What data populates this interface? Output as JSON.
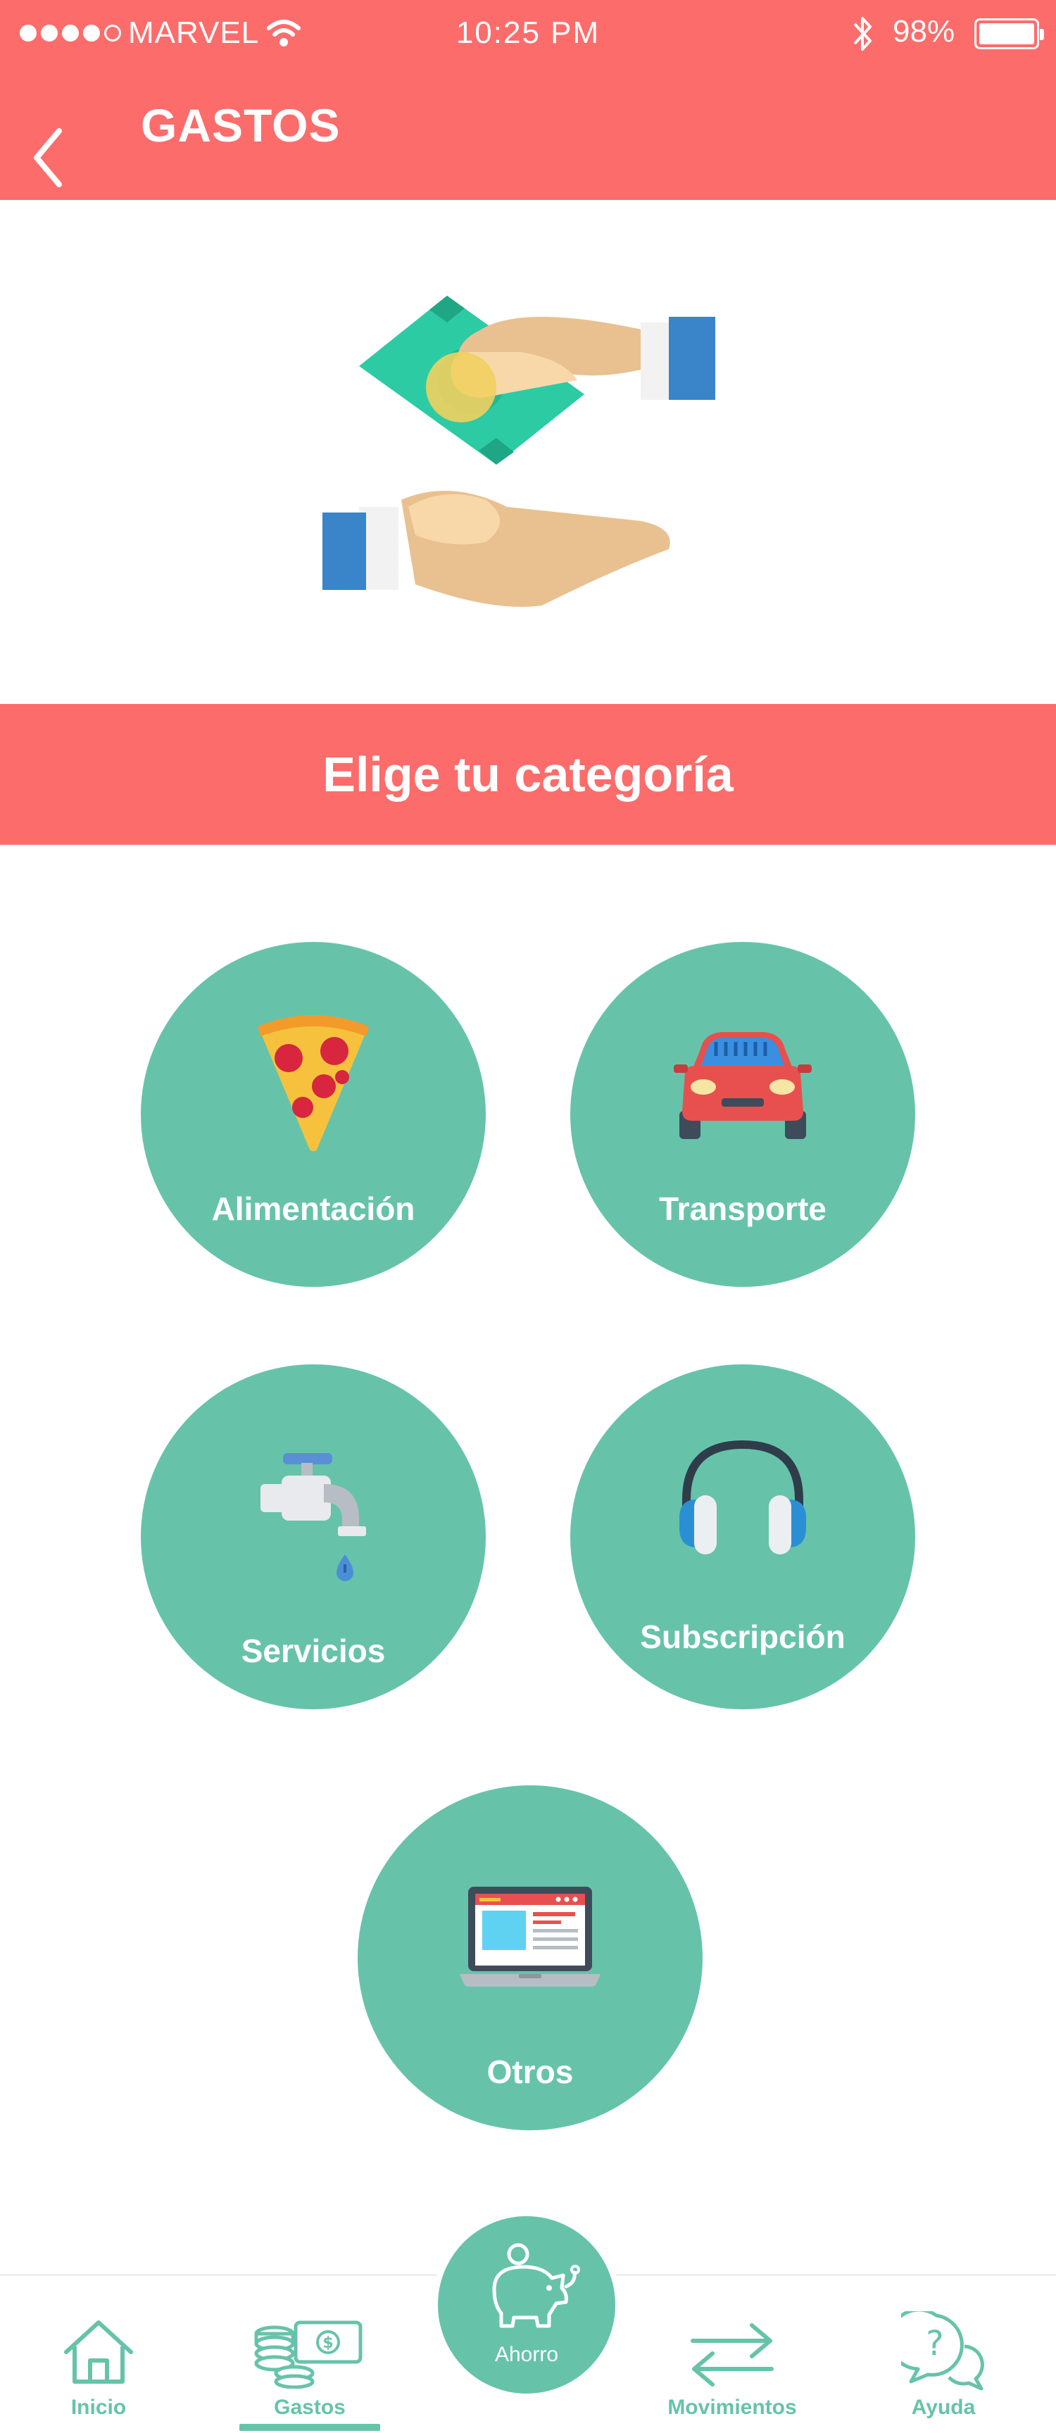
{
  "status_bar": {
    "carrier": "MARVEL",
    "time": "10:25 PM",
    "battery": "98%",
    "signal_bars_filled": 4,
    "signal_bars_total": 5
  },
  "header": {
    "title": "GASTOS",
    "back_icon": "chevron-left-icon"
  },
  "hero": {
    "icon": "money-exchange-hands-icon"
  },
  "banner": {
    "text": "Elige tu categoría"
  },
  "categories": [
    {
      "label": "Alimentación",
      "icon": "pizza-slice-icon"
    },
    {
      "label": "Transporte",
      "icon": "car-icon"
    },
    {
      "label": "Servicios",
      "icon": "water-faucet-icon"
    },
    {
      "label": "Subscripción",
      "icon": "headphones-icon"
    },
    {
      "label": "Otros",
      "icon": "laptop-icon"
    }
  ],
  "bottom_nav": {
    "items": [
      {
        "label": "Inicio",
        "icon": "home-icon"
      },
      {
        "label": "Gastos",
        "icon": "coins-money-icon",
        "active": true
      },
      {
        "label": "Ahorro",
        "icon": "piggy-bank-icon"
      },
      {
        "label": "Movimientos",
        "icon": "transfer-arrows-icon"
      },
      {
        "label": "Ayuda",
        "icon": "help-chat-icon"
      }
    ]
  },
  "colors": {
    "primary": "#FC6C6B",
    "accent": "#66C3AA",
    "background": "#FFFFFF"
  }
}
